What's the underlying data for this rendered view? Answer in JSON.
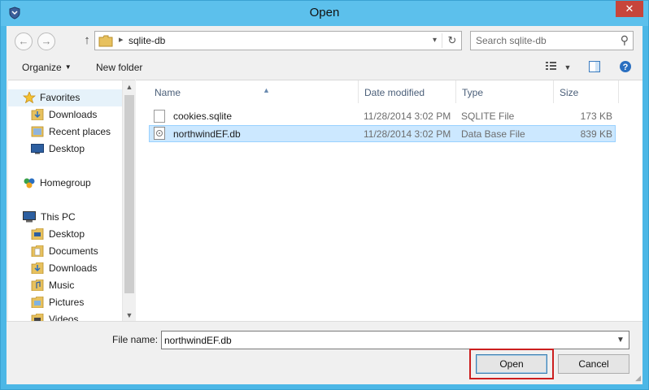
{
  "window": {
    "title": "Open",
    "close_glyph": "✕"
  },
  "address_bar": {
    "breadcrumb": "sqlite-db",
    "separator": "▸"
  },
  "search": {
    "placeholder": "Search sqlite-db"
  },
  "toolbar": {
    "organize_label": "Organize",
    "new_folder_label": "New folder"
  },
  "nav_pane": {
    "items": [
      {
        "label": "Favorites",
        "icon": "star-icon"
      },
      {
        "label": "Downloads",
        "icon": "downloads-folder-icon"
      },
      {
        "label": "Recent places",
        "icon": "recent-places-icon"
      },
      {
        "label": "Desktop",
        "icon": "desktop-icon"
      },
      {
        "label": "Homegroup",
        "icon": "homegroup-icon"
      },
      {
        "label": "This PC",
        "icon": "computer-icon"
      },
      {
        "label": "Desktop",
        "icon": "folder-icon"
      },
      {
        "label": "Documents",
        "icon": "folder-icon"
      },
      {
        "label": "Downloads",
        "icon": "folder-icon"
      },
      {
        "label": "Music",
        "icon": "folder-icon"
      },
      {
        "label": "Pictures",
        "icon": "folder-icon"
      },
      {
        "label": "Videos",
        "icon": "folder-icon"
      }
    ]
  },
  "file_list": {
    "columns": {
      "name": "Name",
      "date_modified": "Date modified",
      "type": "Type",
      "size": "Size"
    },
    "rows": [
      {
        "name": "cookies.sqlite",
        "date_modified": "11/28/2014 3:02 PM",
        "type": "SQLITE File",
        "size": "173 KB",
        "selected": false
      },
      {
        "name": "northwindEF.db",
        "date_modified": "11/28/2014 3:02 PM",
        "type": "Data Base File",
        "size": "839 KB",
        "selected": true
      }
    ]
  },
  "bottom": {
    "file_name_label": "File name:",
    "file_name_value": "northwindEF.db",
    "open_label": "Open",
    "cancel_label": "Cancel"
  },
  "colors": {
    "title_bar": "#5cc0ec",
    "close_button": "#c7453b",
    "selection": "#cce8ff",
    "highlight_frame": "#cc1f1f"
  }
}
